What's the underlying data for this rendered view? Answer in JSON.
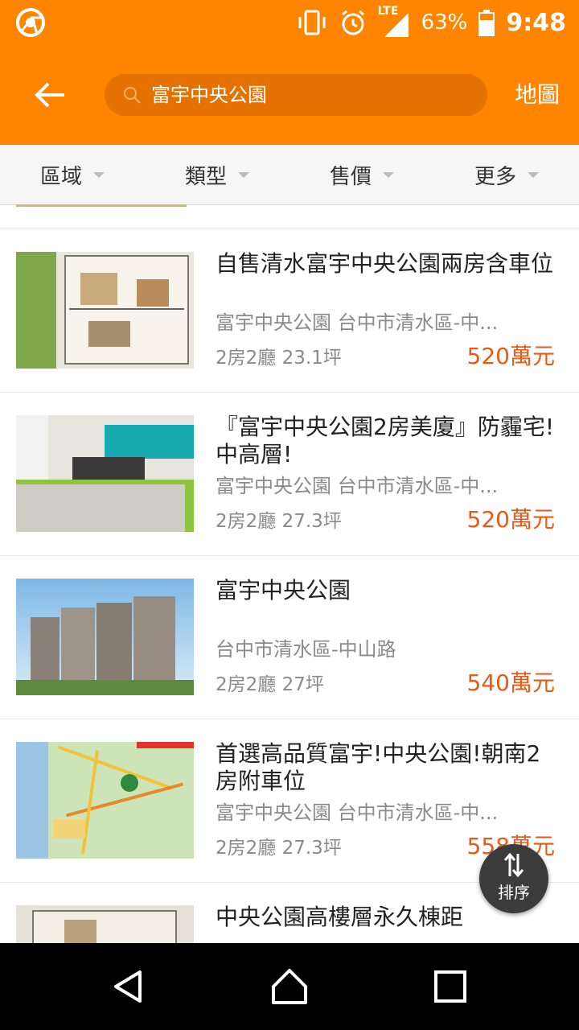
{
  "status_bar": {
    "battery_percent": "63%",
    "network": "LTE",
    "time": "9:48"
  },
  "header": {
    "search_query": "富宇中央公園",
    "map_label": "地圖"
  },
  "filters": [
    {
      "label": "區域"
    },
    {
      "label": "類型"
    },
    {
      "label": "售價"
    },
    {
      "label": "更多"
    }
  ],
  "listings": [
    {
      "title": "自售清水富宇中央公園兩房含車位",
      "subtitle": "富宇中央公園 台中市清水區-中...",
      "spec": "2房2廳 23.1坪",
      "price": "520萬元"
    },
    {
      "title": "『富宇中央公園2房美廈』防霾宅!中高層!",
      "subtitle": "富宇中央公園 台中市清水區-中...",
      "spec": "2房2廳 27.3坪",
      "price": "520萬元"
    },
    {
      "title": "富宇中央公園",
      "subtitle": "台中市清水區-中山路",
      "spec": "2房2廳 27坪",
      "price": "540萬元"
    },
    {
      "title": "首選高品質富宇!中央公園!朝南2房附車位",
      "subtitle": "富宇中央公園 台中市清水區-中...",
      "spec": "2房2廳 27.3坪",
      "price": "558萬元"
    },
    {
      "title": "中央公園高樓層永久棟距",
      "subtitle": "",
      "spec": "",
      "price": ""
    }
  ],
  "sort_button": {
    "label": "排序"
  },
  "colors": {
    "brand": "#ff8400",
    "price": "#ea5a16"
  }
}
